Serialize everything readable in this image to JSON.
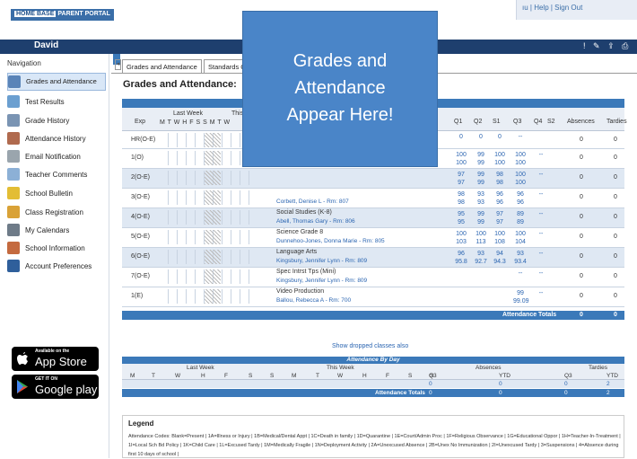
{
  "header": {
    "logo_text": "HOME BASE",
    "logo_subtitle": "PARENT PORTAL",
    "user_links": "ıu | Help | Sign Out",
    "username": "David"
  },
  "sidebar": {
    "title": "Navigation",
    "items": [
      {
        "label": "Grades and Attendance",
        "icon": "grades-icon",
        "color": "#5a84b8"
      },
      {
        "label": "Test Results",
        "icon": "test-results-icon",
        "color": "#6b9fd0"
      },
      {
        "label": "Grade History",
        "icon": "grade-history-icon",
        "color": "#7a94b3"
      },
      {
        "label": "Attendance History",
        "icon": "attendance-history-icon",
        "color": "#b06a4e"
      },
      {
        "label": "Email Notification",
        "icon": "email-icon",
        "color": "#9aa5ad"
      },
      {
        "label": "Teacher Comments",
        "icon": "teacher-comments-icon",
        "color": "#8cb0d6"
      },
      {
        "label": "School Bulletin",
        "icon": "bulletin-icon",
        "color": "#e3bd34"
      },
      {
        "label": "Class Registration",
        "icon": "registration-icon",
        "color": "#d9a237"
      },
      {
        "label": "My Calendars",
        "icon": "calendar-icon",
        "color": "#6e7b88"
      },
      {
        "label": "School Information",
        "icon": "school-icon",
        "color": "#c46a3f"
      },
      {
        "label": "Account Preferences",
        "icon": "account-icon",
        "color": "#2f5f9b"
      }
    ],
    "app_store": {
      "top": "Available on the",
      "main": "App Store"
    },
    "google_play": {
      "top": "GET IT ON",
      "main": "Google play"
    }
  },
  "tabs": [
    {
      "label": "Grades and Attendance"
    },
    {
      "label": "Standards G"
    }
  ],
  "page_title": "Grades and Attendance:",
  "grades": {
    "headers": {
      "exp": "Exp",
      "last_week": "Last Week",
      "this_week": "This",
      "days": "M T W H F S S M T W",
      "q1": "Q1",
      "q2": "Q2",
      "s1": "S1",
      "q3": "Q3",
      "q4": "Q4",
      "s2": "S2",
      "absences": "Absences",
      "tardies": "Tardies"
    },
    "rows": [
      {
        "exp": "HR(O-E)",
        "course": "",
        "teacher": "",
        "g1": "0",
        "g2": "0",
        "g3": "0",
        "g4": "--",
        "g5": "",
        "g6": "",
        "abs": "0",
        "tar": "0"
      },
      {
        "exp": "1(O)",
        "course": "",
        "teacher": "",
        "g1": "100\n100",
        "g2": "99\n99",
        "g3": "100\n100",
        "g4": "100\n100",
        "g5": "--",
        "g6": "",
        "abs": "0",
        "tar": "0"
      },
      {
        "exp": "2(O-E)",
        "course": "",
        "teacher": "",
        "g1": "97\n97",
        "g2": "99\n99",
        "g3": "98\n98",
        "g4": "100\n100",
        "g5": "--",
        "g6": "",
        "abs": "0",
        "tar": "0"
      },
      {
        "exp": "3(O-E)",
        "course": "",
        "teacher": "Corbett, Denise L - Rm: 807",
        "g1": "98\n98",
        "g2": "93\n93",
        "g3": "96\n96",
        "g4": "96\n96",
        "g5": "--",
        "g6": "",
        "abs": "0",
        "tar": "0"
      },
      {
        "exp": "4(O-E)",
        "course": "Social Studies (K-8)",
        "teacher": "Abell, Thomas Gary - Rm: 806",
        "g1": "95\n95",
        "g2": "99\n99",
        "g3": "97\n97",
        "g4": "89\n89",
        "g5": "--",
        "g6": "",
        "abs": "0",
        "tar": "0"
      },
      {
        "exp": "5(O-E)",
        "course": "Science Grade 8",
        "teacher": "Dunnehoo-Jones, Donna Marie - Rm: 805",
        "g1": "100\n103",
        "g2": "100\n113",
        "g3": "100\n108",
        "g4": "100\n104",
        "g5": "--",
        "g6": "",
        "abs": "0",
        "tar": "0"
      },
      {
        "exp": "6(O-E)",
        "course": "Language Arts",
        "teacher": "Kingsbury, Jennifer Lynn - Rm: 809",
        "g1": "96\n95.8",
        "g2": "93\n92.7",
        "g3": "94\n94.3",
        "g4": "93\n93.4",
        "g5": "--",
        "g6": "",
        "abs": "0",
        "tar": "0"
      },
      {
        "exp": "7(O-E)",
        "course": "Spec Intrst Tps (Mini)",
        "teacher": "Kingsbury, Jennifer Lynn - Rm: 809",
        "g1": "",
        "g2": "",
        "g3": "",
        "g4": "--",
        "g5": "--",
        "g6": "",
        "abs": "0",
        "tar": "0"
      },
      {
        "exp": "1(E)",
        "course": "Video Production",
        "teacher": "Ballou, Rebecca A - Rm: 700",
        "g1": "",
        "g2": "",
        "g3": "",
        "g4": "99\n99.09",
        "g5": "--",
        "g6": "",
        "abs": "0",
        "tar": "0"
      }
    ],
    "totals": {
      "label": "Attendance Totals",
      "abs": "0",
      "tar": "0"
    }
  },
  "dropped_link": "Show dropped classes also",
  "abd": {
    "title": "Attendance By Day",
    "last_week": "Last Week",
    "this_week": "This Week",
    "absences": "Absences",
    "tardies": "Tardies",
    "days": [
      "M",
      "T",
      "W",
      "H",
      "F",
      "S",
      "S",
      "M",
      "T",
      "W",
      "H",
      "F",
      "S",
      "S"
    ],
    "q3": "Q3",
    "ytd": "YTD",
    "vals": {
      "abs_q3": "0",
      "abs_ytd": "0",
      "tar_q3": "0",
      "tar_ytd": "2"
    },
    "totals_label": "Attendance Totals",
    "totals": {
      "abs_q3": "0",
      "abs_ytd": "0",
      "tar_q3": "0",
      "tar_ytd": "2"
    }
  },
  "legend": {
    "title": "Legend",
    "text": "Attendance Codes: Blank=Present | 1A=Illness or Injury | 1B=Medical/Dental Appt | 1C=Death in family | 1D=Quarantine | 1E=Court/Admin Proc | 1F=Religious Observance | 1G=Educational Oppor | 1H=Teacher-In-Treatment | 1I=Local Sch Bd Policy | 1K=Child Care | 1L=Excused Tardy | 1M=Medically Fragile | 1N=Deployment Activity | 2A=Unexcused Absence | 2B=Unex No Immunization | 2I=Unexcused Tardy | 3=Suspensions | 4=Absence during first 10 days of school |"
  },
  "overlay": {
    "line1": "Grades and",
    "line2": "Attendance",
    "line3": "Appear Here!"
  }
}
